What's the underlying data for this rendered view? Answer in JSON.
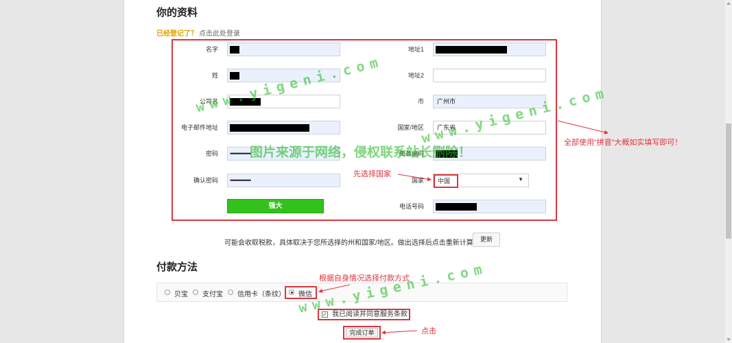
{
  "section_info": {
    "title": "你的资料"
  },
  "login": {
    "question": "已经登记了？",
    "link": "点击此处登录"
  },
  "left_fields": [
    {
      "label": "名字"
    },
    {
      "label": "姓"
    },
    {
      "label": "公司名"
    },
    {
      "label": "电子邮件地址"
    },
    {
      "label": "密码",
      "value": "••••••••••••••"
    },
    {
      "label": "确认密码",
      "value": "••••••••••••••"
    }
  ],
  "strength_button": "强大",
  "right_fields": [
    {
      "label": "地址1",
      "value": ""
    },
    {
      "label": "地址2",
      "value": ""
    },
    {
      "label": "市",
      "value": "广州市"
    },
    {
      "label": "国家/地区",
      "value": "广东省"
    },
    {
      "label": "邮政编码",
      "value": ""
    },
    {
      "label": "国家",
      "value": "中国"
    },
    {
      "label": "电话号码",
      "value": ""
    }
  ],
  "tax_note": "可能会收取税款，具体取决于您所选择的州和国家/地区。做出选择后点击重新计算。",
  "refresh_button": "更新",
  "section_payment": {
    "title": "付款方法"
  },
  "payment_options": [
    "贝宝",
    "支付宝",
    "信用卡（条纹）",
    "微信"
  ],
  "agree_label": "我已阅读并同意服务条款",
  "finish_button": "完成订单",
  "annotations": {
    "right_note": "全部使用“拼音”大概如实填写即可！",
    "country_note": "先选择国家",
    "payment_note": "根据自身情况选择付款方式",
    "click_note": "点击"
  },
  "watermarks": {
    "url": "www.yigeni.com",
    "notice": "图片来源于网络，侵权联系站长删除！"
  },
  "colors": {
    "annotation": "#e0333c",
    "strength": "#33c21b",
    "watermark": "#2fbf2f"
  }
}
